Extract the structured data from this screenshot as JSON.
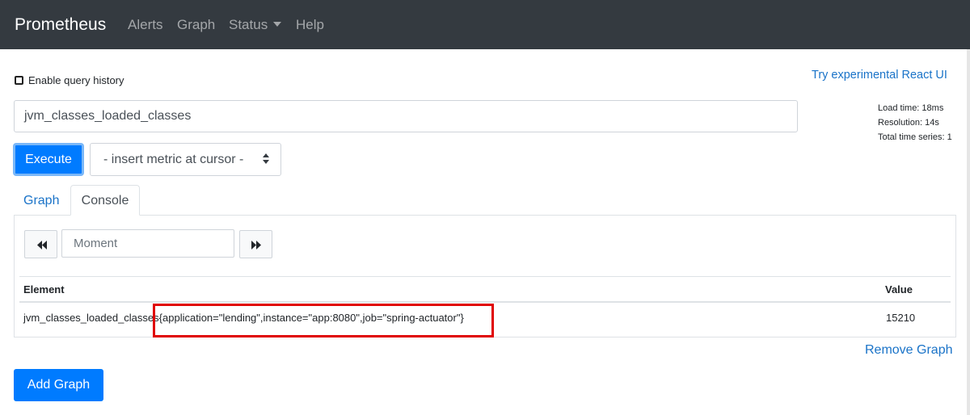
{
  "navbar": {
    "brand": "Prometheus",
    "items": [
      {
        "label": "Alerts"
      },
      {
        "label": "Graph"
      },
      {
        "label": "Status"
      },
      {
        "label": "Help"
      }
    ]
  },
  "query_history": {
    "label": "Enable query history",
    "checked": false
  },
  "react_link": "Try experimental React UI",
  "expression": {
    "value": "jvm_classes_loaded_classes"
  },
  "stats": {
    "load_time": "Load time: 18ms",
    "resolution": "Resolution: 14s",
    "total_series": "Total time series: 1"
  },
  "execute_label": "Execute",
  "metric_select": {
    "selected": "- insert metric at cursor -"
  },
  "tabs": [
    {
      "label": "Graph",
      "active": false
    },
    {
      "label": "Console",
      "active": true
    }
  ],
  "moment": {
    "placeholder": "Moment",
    "back_icon": "fast-backward-icon",
    "forward_icon": "fast-forward-icon"
  },
  "table": {
    "headers": {
      "element": "Element",
      "value": "Value"
    },
    "rows": [
      {
        "metric": "jvm_classes_loaded_classes",
        "labels": "{application=\"lending\",instance=\"app:8080\",job=\"spring-actuator\"}",
        "value": "15210"
      }
    ]
  },
  "remove_graph": "Remove Graph",
  "add_graph": "Add Graph",
  "colors": {
    "navbar": "#343a40",
    "primary": "#007bff",
    "link": "#1a73c8",
    "highlight": "#e00000"
  }
}
